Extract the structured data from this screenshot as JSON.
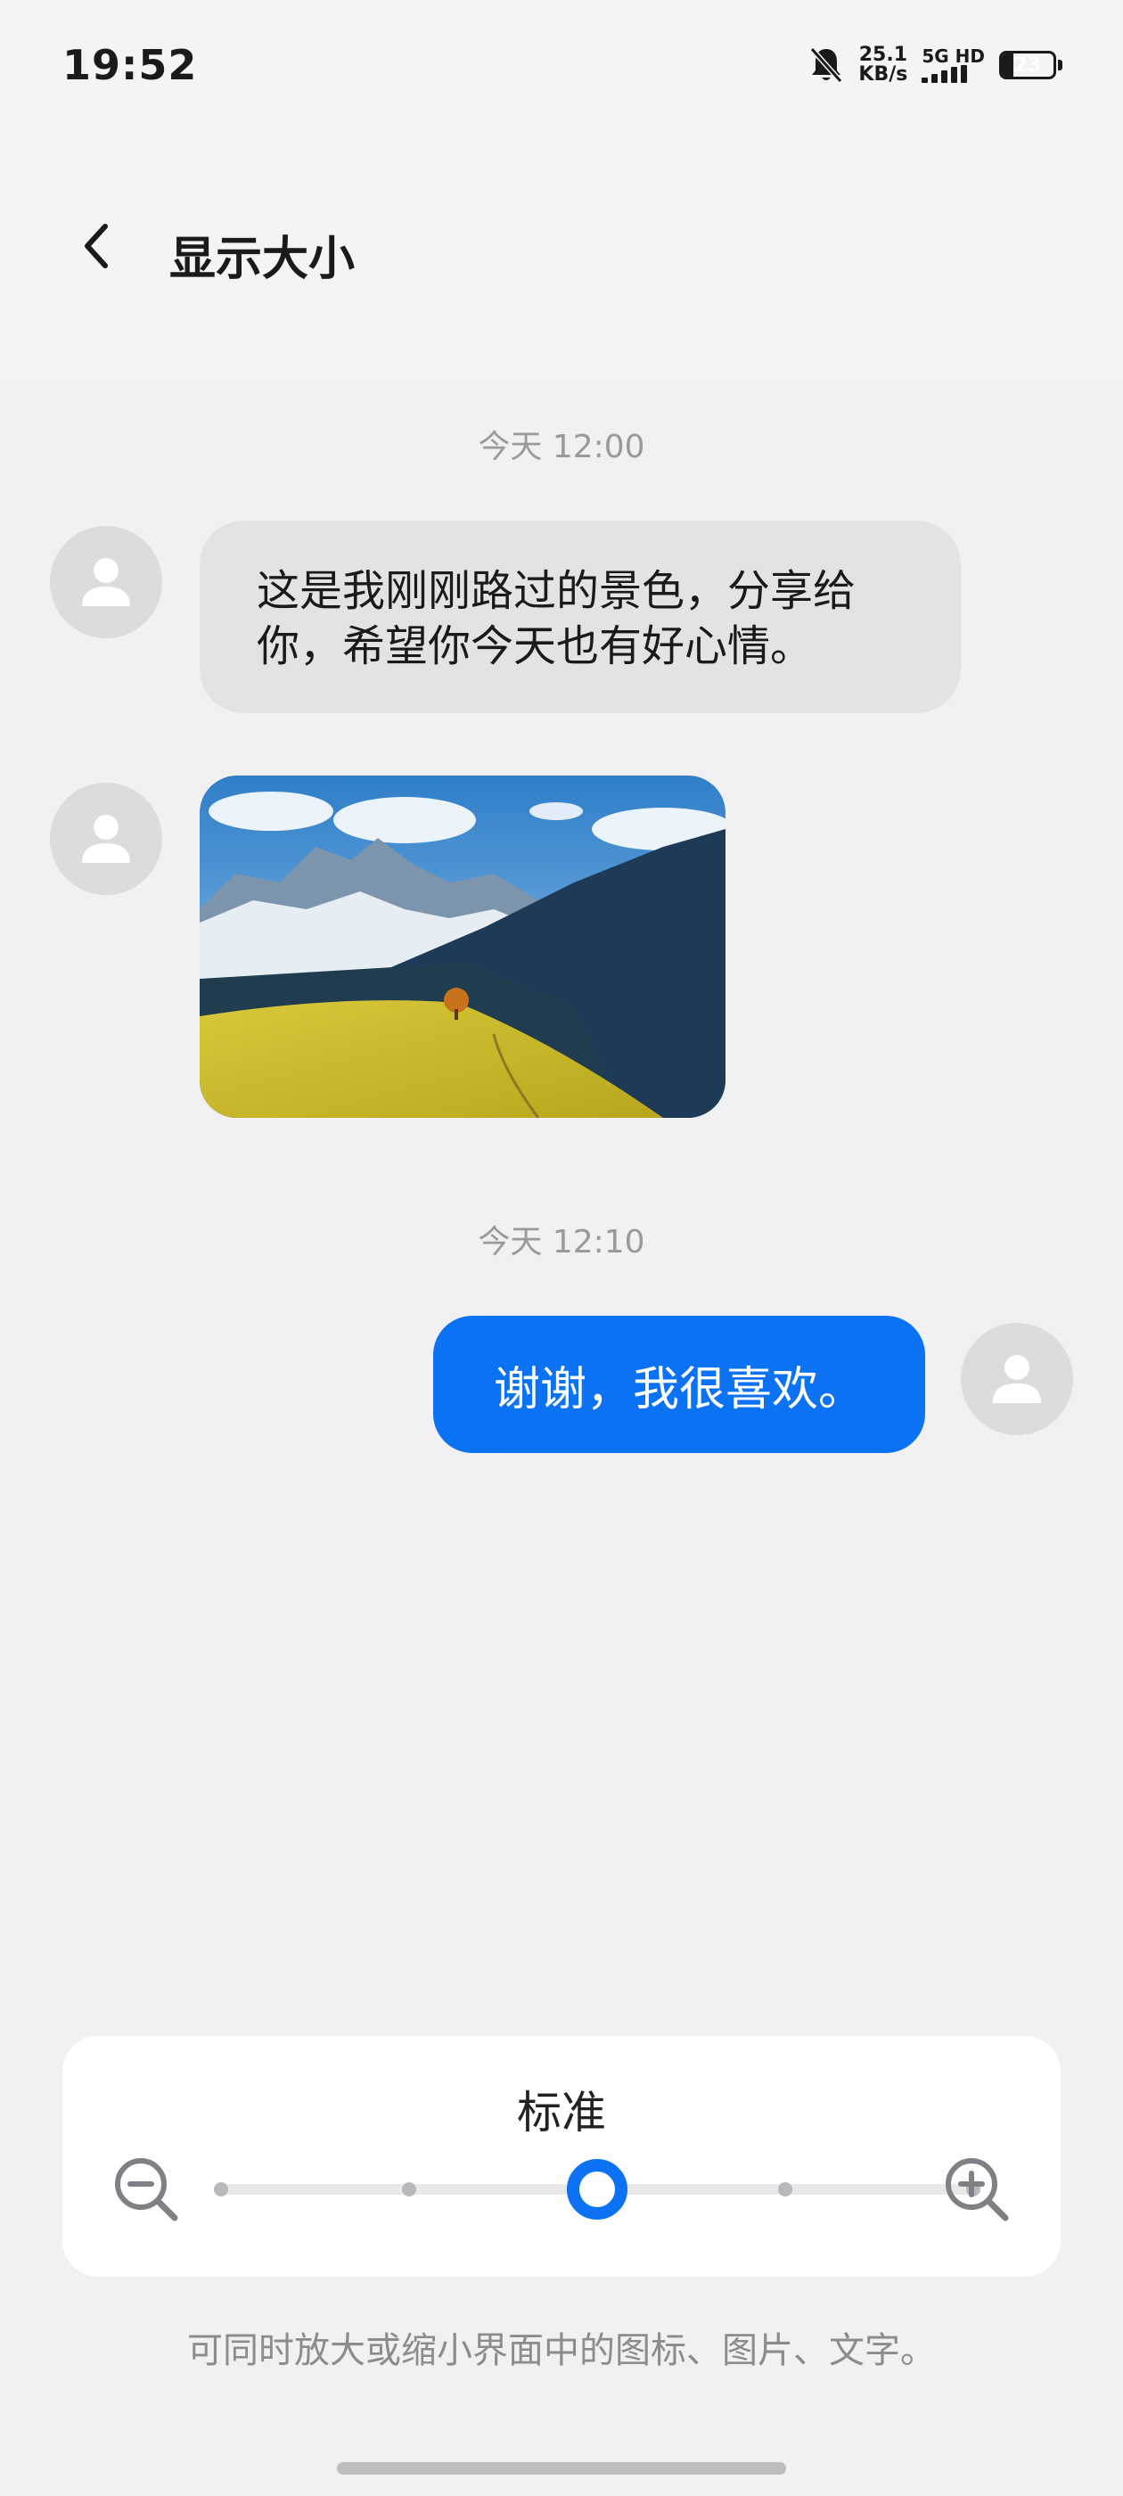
{
  "status_bar": {
    "time": "19:52",
    "net_speed_value": "25.1",
    "net_speed_unit": "KB/s",
    "network_type": "5G HD",
    "signal_bars": 4,
    "battery_level": "23",
    "battery_percent": 23
  },
  "header": {
    "title": "显示大小",
    "back_icon": "chevron-left-icon"
  },
  "preview": {
    "messages": [
      {
        "type": "timestamp",
        "text": "今天 12:00"
      },
      {
        "type": "text",
        "direction": "incoming",
        "text": "这是我刚刚路过的景色，分享给你，希望你今天也有好心情。"
      },
      {
        "type": "image",
        "direction": "incoming",
        "image": "mountain-landscape-photo"
      },
      {
        "type": "timestamp",
        "text": "今天 12:10"
      },
      {
        "type": "text",
        "direction": "outgoing",
        "text": "谢谢，我很喜欢。"
      }
    ]
  },
  "size_control": {
    "label": "标准",
    "levels": 5,
    "selected_index": 2,
    "zoom_out_icon": "zoom-out-icon",
    "zoom_in_icon": "zoom-in-icon",
    "accent_color": "#0a72f3"
  },
  "hint": "可同时放大或缩小界面中的图标、图片、文字。"
}
